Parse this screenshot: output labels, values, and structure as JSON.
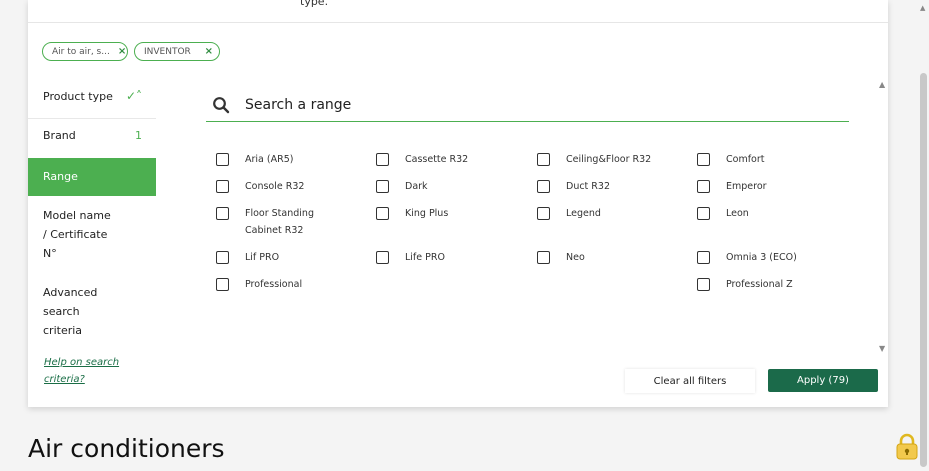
{
  "panel": {
    "cut_text": "type."
  },
  "chips": [
    {
      "label": "Air to air, s...",
      "remove": "×"
    },
    {
      "label": "INVENTOR",
      "remove": "×"
    }
  ],
  "sidebar": {
    "product_type": "Product type",
    "product_type_status": "✓˄",
    "brand": "Brand",
    "brand_count": "1",
    "range": "Range",
    "model_line1": "Model name",
    "model_line2": "/ Certificate",
    "model_line3": "N°",
    "advanced_line1": "Advanced",
    "advanced_line2": "search",
    "advanced_line3": "criteria",
    "help_line1": "Help on search",
    "help_line2": "criteria?"
  },
  "search": {
    "placeholder": "Search a range",
    "icon": "search-icon"
  },
  "options": [
    {
      "label": "Aria (AR5)",
      "checked": false
    },
    {
      "label": "Cassette R32",
      "checked": false
    },
    {
      "label": "Ceiling&Floor R32",
      "checked": false
    },
    {
      "label": "Comfort",
      "checked": false
    },
    {
      "label": "Console R32",
      "checked": false
    },
    {
      "label": "Dark",
      "checked": false
    },
    {
      "label": "Duct R32",
      "checked": false
    },
    {
      "label": "Emperor",
      "checked": false
    },
    {
      "label": "Floor Standing",
      "label2": "Cabinet R32",
      "checked": false
    },
    {
      "label": "King Plus",
      "checked": false
    },
    {
      "label": "Legend",
      "checked": false
    },
    {
      "label": "Leon",
      "checked": false
    },
    {
      "label": "Lif PRO",
      "checked": false
    },
    {
      "label": "Life PRO",
      "checked": false
    },
    {
      "label": "Neo",
      "checked": false
    },
    {
      "label": "Omnia 3 (ECO)",
      "checked": false
    },
    {
      "label": "Professional",
      "checked": false
    },
    {
      "label": "Professional Z",
      "checked": false
    }
  ],
  "actions": {
    "clear": "Clear all filters",
    "apply": "Apply (79)"
  },
  "page": {
    "heading": "Air conditioners"
  },
  "colors": {
    "accent": "#4caf50",
    "apply_bg": "#1b6a4a"
  }
}
